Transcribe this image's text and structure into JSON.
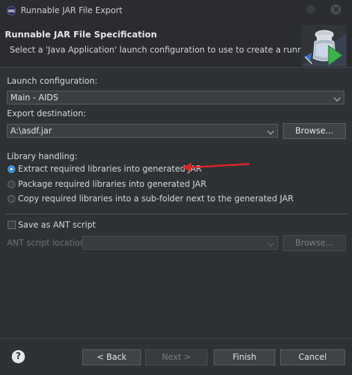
{
  "window": {
    "title": "Runnable JAR File Export"
  },
  "header": {
    "title": "Runnable JAR File Specification",
    "description": "Select a 'Java Application' launch configuration to use to create a runnable JAR."
  },
  "launch": {
    "label": "Launch configuration:",
    "value": "Main - AIDS"
  },
  "export": {
    "label": "Export destination:",
    "value": "A:\\asdf.jar",
    "browse_label": "Browse..."
  },
  "library": {
    "label": "Library handling:",
    "options": [
      {
        "label": "Extract required libraries into generated JAR",
        "selected": true
      },
      {
        "label": "Package required libraries into generated JAR",
        "selected": false
      },
      {
        "label": "Copy required libraries into a sub-folder next to the generated JAR",
        "selected": false
      }
    ]
  },
  "ant": {
    "checkbox_label": "Save as ANT script",
    "checked": false,
    "location_label": "ANT script location:",
    "location_value": "",
    "browse_label": "Browse..."
  },
  "footer": {
    "back_label": "< Back",
    "next_label": "Next >",
    "finish_label": "Finish",
    "cancel_label": "Cancel",
    "help_glyph": "?"
  },
  "colors": {
    "background": "#2f3235",
    "accent_radio": "#3d8fd6",
    "annotation_arrow": "#e02424"
  }
}
